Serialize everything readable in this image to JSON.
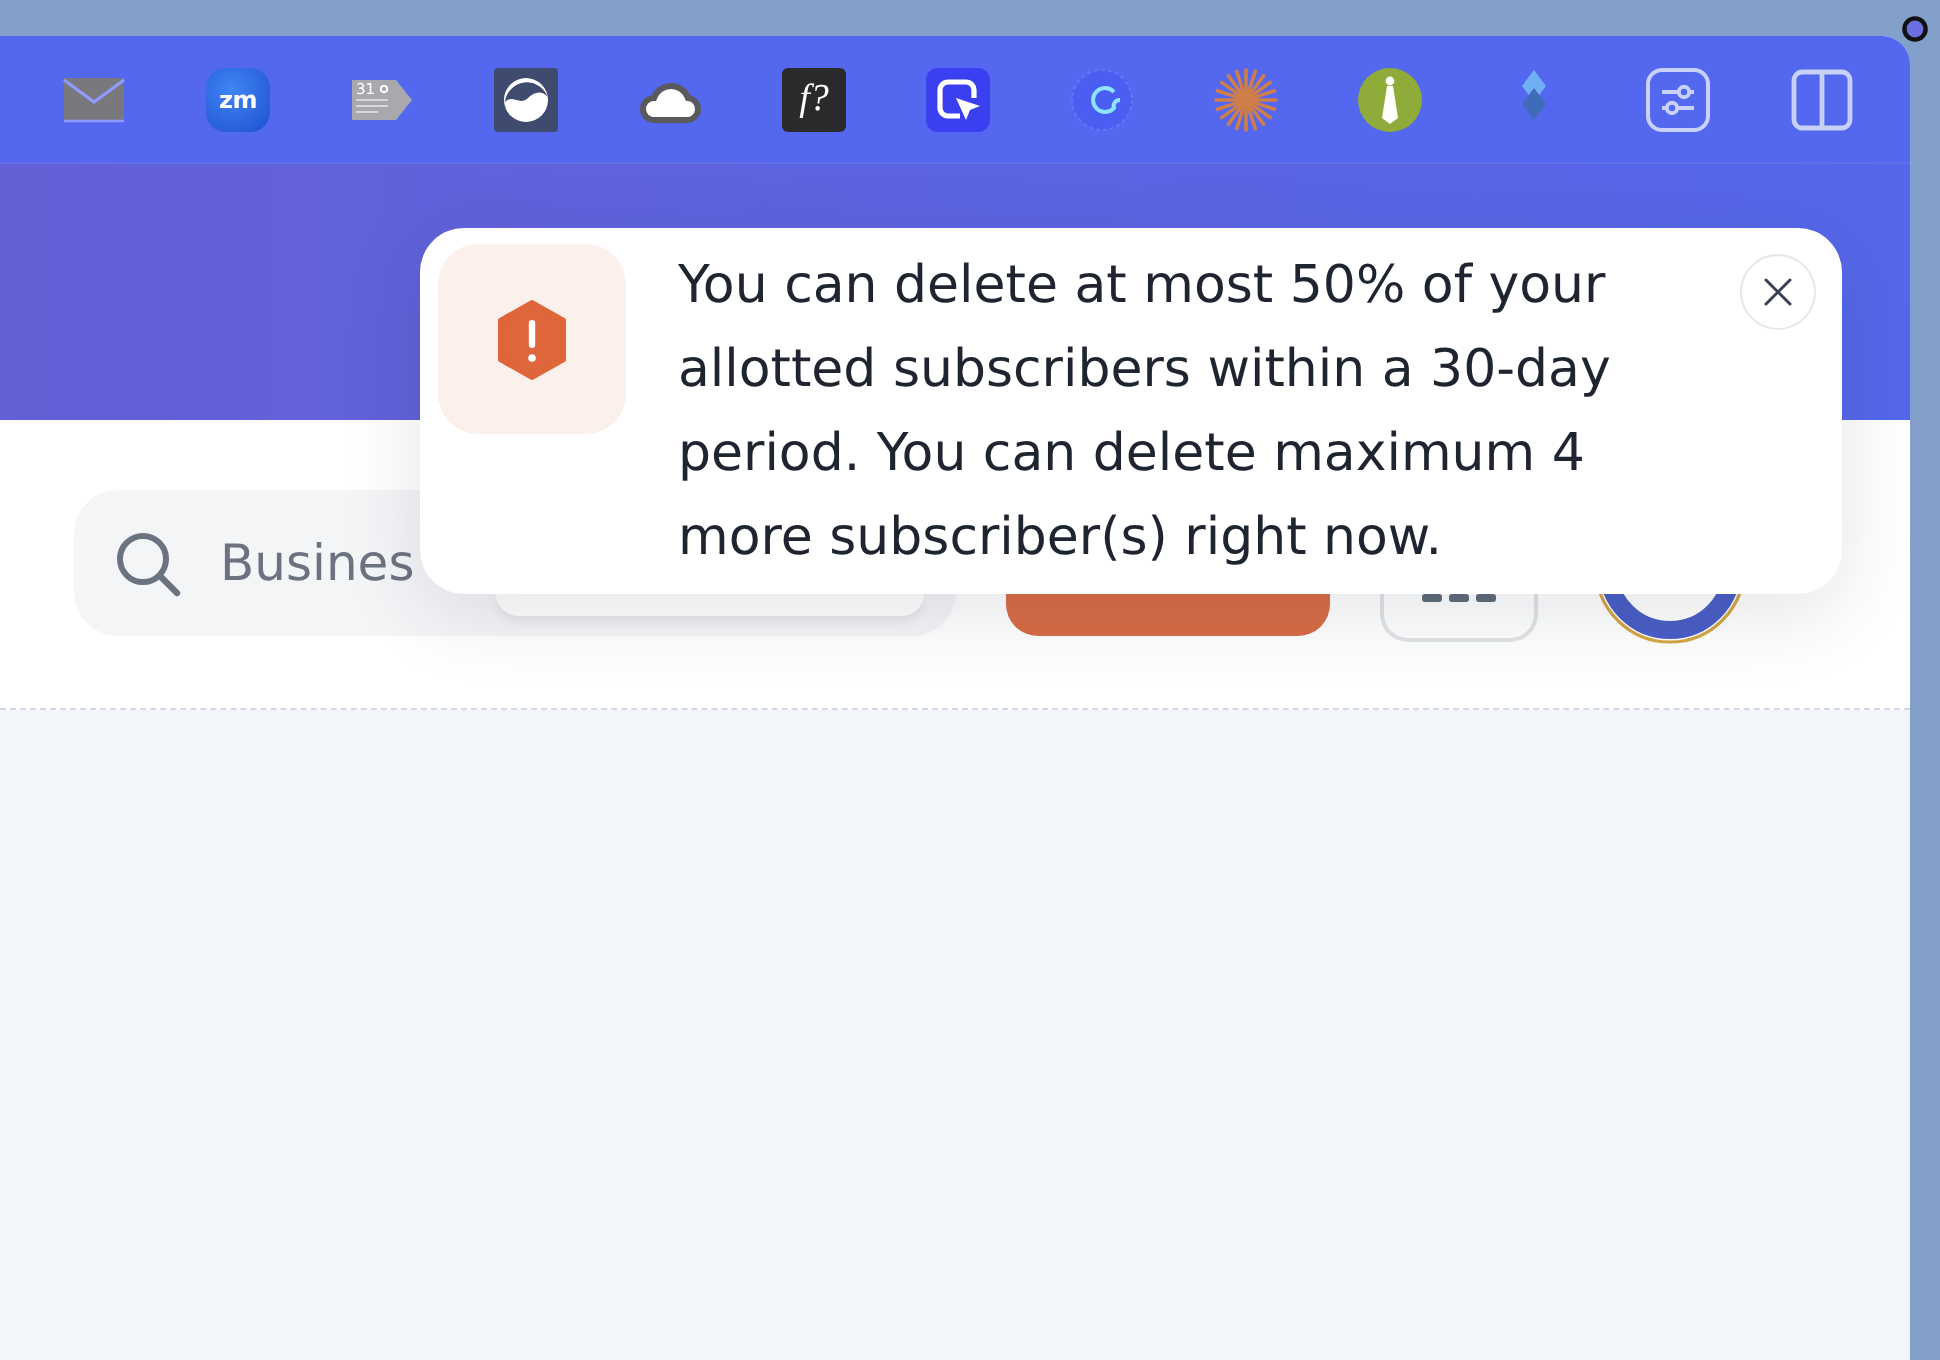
{
  "toolbar": {
    "apps": [
      {
        "kind": "mail"
      },
      {
        "kind": "zm",
        "label": "zm"
      },
      {
        "kind": "calendar",
        "label": "31"
      },
      {
        "kind": "wave"
      },
      {
        "kind": "cloud"
      },
      {
        "kind": "formula",
        "label": "f?"
      },
      {
        "kind": "cursor"
      },
      {
        "kind": "loop"
      },
      {
        "kind": "burst"
      },
      {
        "kind": "tie"
      },
      {
        "kind": "diamonds"
      },
      {
        "kind": "sliders"
      },
      {
        "kind": "split"
      }
    ]
  },
  "header": {
    "search": {
      "placeholder": "Busines"
    }
  },
  "toast": {
    "kind": "warning",
    "message": "You can delete at most 50% of your allotted subscribers within a 30-day period. You can delete maximum 4 more subscriber(s) right now."
  }
}
